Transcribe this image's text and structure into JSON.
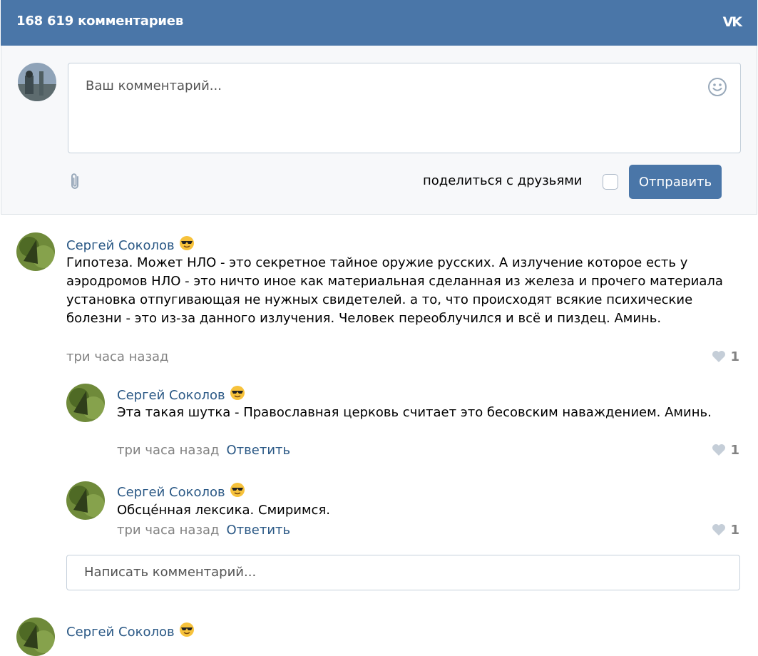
{
  "header": {
    "title": "168 619 комментариев",
    "logo": "VK"
  },
  "composer": {
    "placeholder": "Ваш комментарий...",
    "share_label": "поделиться с друзьями",
    "send_label": "Отправить"
  },
  "comments": [
    {
      "author": "Сергей Соколов",
      "text": "Гипотеза. Может НЛО - это секретное тайное оружие русских. А излучение которое есть у аэродромов НЛО - это ничто иное как материальная сделанная из железа и прочего материала установка отпугивающая не нужных свидетелей. а то, что происходят всякие психические болезни - это из-за данного излучения. Человек переоблучился и всё и пиздец. Аминь.",
      "time": "три часа назад",
      "likes": "1",
      "replies": [
        {
          "author": "Сергей Соколов",
          "text": "Эта такая шутка - Православная церковь считает это бесовским наваждением. Аминь.",
          "time": "три часа назад",
          "reply_label": "Ответить",
          "likes": "1"
        },
        {
          "author": "Сергей Соколов",
          "text": "Обсце́нная лексика. Смиримся.",
          "time": "три часа назад",
          "reply_label": "Ответить",
          "likes": "1"
        }
      ],
      "reply_placeholder": "Написать комментарий..."
    },
    {
      "author": "Сергей Соколов"
    }
  ],
  "colors": {
    "header_bg": "#4a76a8",
    "link": "#2a5885",
    "meta": "#828282"
  }
}
